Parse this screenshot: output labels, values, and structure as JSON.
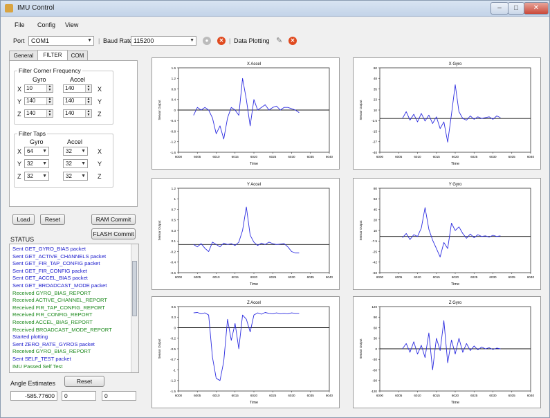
{
  "window": {
    "title": "IMU Control"
  },
  "menu": [
    "File",
    "Config",
    "View"
  ],
  "toolbar": {
    "port_label": "Port",
    "port_value": "COM1",
    "baud_label": "Baud Rate",
    "baud_value": "115200",
    "plotting_label": "Data Plotting"
  },
  "tabs": [
    "General",
    "FILTER",
    "COM"
  ],
  "filter": {
    "corner_title": "Filter Corner Frequency",
    "gyro_header": "Gyro",
    "accel_header": "Accel",
    "axes": [
      "X",
      "Y",
      "Z"
    ],
    "corner_gyro": [
      "10",
      "140",
      "140"
    ],
    "corner_accel": [
      "140",
      "140",
      "140"
    ],
    "taps_title": "Filter Taps",
    "taps_gyro": [
      "64",
      "32",
      "32"
    ],
    "taps_accel": [
      "32",
      "32",
      "32"
    ]
  },
  "buttons": {
    "load": "Load",
    "reset": "Reset",
    "ram_commit": "RAM Commit",
    "flash_commit": "FLASH Commit",
    "angle_reset": "Reset"
  },
  "status": {
    "title": "STATUS",
    "colors": {
      "sent": "#1a1acc",
      "received": "#1e8a1e"
    },
    "lines": [
      {
        "text": "Sent GET_GYRO_BIAS packet",
        "kind": "sent"
      },
      {
        "text": "Sent GET_ACTIVE_CHANNELS packet",
        "kind": "sent"
      },
      {
        "text": "Sent GET_FIR_TAP_CONFIG packet",
        "kind": "sent"
      },
      {
        "text": "Sent GET_FIR_CONFIG packet",
        "kind": "sent"
      },
      {
        "text": "Sent GET_ACCEL_BIAS packet",
        "kind": "sent"
      },
      {
        "text": "Sent GET_BROADCAST_MODE packet",
        "kind": "sent"
      },
      {
        "text": "Received GYRO_BIAS_REPORT",
        "kind": "received"
      },
      {
        "text": "Received ACTIVE_CHANNEL_REPORT",
        "kind": "received"
      },
      {
        "text": "Received FIR_TAP_CONFIG_REPORT",
        "kind": "received"
      },
      {
        "text": "Received FIR_CONFIG_REPORT",
        "kind": "received"
      },
      {
        "text": "Received ACCEL_BIAS_REPORT",
        "kind": "received"
      },
      {
        "text": "Received BROADCAST_MODE_REPORT",
        "kind": "received"
      },
      {
        "text": "Started plotting",
        "kind": "sent"
      },
      {
        "text": "Sent ZERO_RATE_GYROS packet",
        "kind": "sent"
      },
      {
        "text": "Received GYRO_BIAS_REPORT",
        "kind": "received"
      },
      {
        "text": "Sent SELF_TEST packet",
        "kind": "sent"
      },
      {
        "text": "IMU Passed Self Test",
        "kind": "received"
      }
    ]
  },
  "angles": {
    "label": "Angle Estimates",
    "values": [
      "-585.77600",
      "0",
      "0"
    ]
  },
  "chart_data": [
    {
      "type": "line",
      "title": "X Accel",
      "xlabel": "Time",
      "ylabel": "Sensor Output",
      "xlim": [
        6000,
        6040
      ],
      "ylim": [
        -1.6,
        1.6
      ],
      "x": [
        6004,
        6005,
        6006,
        6007,
        6008,
        6009,
        6010,
        6011,
        6012,
        6013,
        6014,
        6015,
        6016,
        6017,
        6018,
        6019,
        6020,
        6021,
        6022,
        6023,
        6024,
        6025,
        6026,
        6027,
        6028,
        6029,
        6030,
        6031,
        6032
      ],
      "y": [
        -0.2,
        0.1,
        0,
        0.1,
        0,
        -0.3,
        -0.9,
        -0.6,
        -1.1,
        -0.3,
        0.1,
        0,
        -0.2,
        1.2,
        0.4,
        -0.6,
        0.4,
        0,
        0.1,
        0.2,
        0,
        0.1,
        0.15,
        0,
        0.1,
        0.1,
        0.05,
        0,
        -0.1
      ]
    },
    {
      "type": "line",
      "title": "X Gyro",
      "xlabel": "Time",
      "ylabel": "Sensor Output",
      "xlim": [
        6000,
        6040
      ],
      "ylim": [
        -40,
        60
      ],
      "x": [
        6006,
        6007,
        6008,
        6009,
        6010,
        6011,
        6012,
        6013,
        6014,
        6015,
        6016,
        6017,
        6018,
        6019,
        6020,
        6021,
        6022,
        6023,
        6024,
        6025,
        6026,
        6027,
        6028,
        6029,
        6030,
        6031,
        6032
      ],
      "y": [
        0,
        8,
        -2,
        5,
        -4,
        6,
        -3,
        4,
        -6,
        2,
        -12,
        -4,
        -28,
        5,
        40,
        8,
        0,
        -2,
        3,
        -1,
        2,
        0,
        1,
        2,
        -1,
        3,
        1
      ]
    },
    {
      "type": "line",
      "title": "Y Accel",
      "xlabel": "Time",
      "ylabel": "Sensor Output",
      "xlim": [
        6000,
        6040
      ],
      "ylim": [
        -0.6,
        1.2
      ],
      "x": [
        6004,
        6005,
        6006,
        6007,
        6008,
        6009,
        6010,
        6011,
        6012,
        6013,
        6014,
        6015,
        6016,
        6017,
        6018,
        6019,
        6020,
        6021,
        6022,
        6023,
        6024,
        6025,
        6026,
        6027,
        6028,
        6029,
        6030,
        6031,
        6032
      ],
      "y": [
        0,
        -0.05,
        0.02,
        -0.08,
        -0.15,
        0.05,
        0,
        -0.05,
        0.03,
        0,
        0.02,
        -0.02,
        0.05,
        0.3,
        0.8,
        0.2,
        0.05,
        -0.02,
        0.03,
        0,
        0.05,
        0.02,
        0,
        0.01,
        0.02,
        -0.05,
        -0.15,
        -0.18,
        -0.18
      ]
    },
    {
      "type": "line",
      "title": "Y Gyro",
      "xlabel": "Time",
      "ylabel": "Sensor Output",
      "xlim": [
        6000,
        6040
      ],
      "ylim": [
        -60,
        80
      ],
      "x": [
        6006,
        6007,
        6008,
        6009,
        6010,
        6011,
        6012,
        6013,
        6014,
        6015,
        6016,
        6017,
        6018,
        6019,
        6020,
        6021,
        6022,
        6023,
        6024,
        6025,
        6026,
        6027,
        6028,
        6029,
        6030,
        6031,
        6032
      ],
      "y": [
        -2,
        5,
        -5,
        3,
        0,
        14,
        48,
        12,
        -6,
        -20,
        -34,
        -10,
        -20,
        22,
        10,
        16,
        5,
        -3,
        4,
        -2,
        3,
        0,
        1,
        -1,
        2,
        0,
        1
      ]
    },
    {
      "type": "line",
      "title": "Z Accel",
      "xlabel": "Time",
      "ylabel": "Sensor Output",
      "xlim": [
        6000,
        6040
      ],
      "ylim": [
        -1.5,
        0.5
      ],
      "x": [
        6004,
        6005,
        6006,
        6007,
        6008,
        6009,
        6010,
        6011,
        6012,
        6013,
        6014,
        6015,
        6016,
        6017,
        6018,
        6019,
        6020,
        6021,
        6022,
        6023,
        6024,
        6025,
        6026,
        6027,
        6028,
        6029,
        6030,
        6031,
        6032
      ],
      "y": [
        0.35,
        0.36,
        0.33,
        0.35,
        0.3,
        -0.7,
        -1.2,
        -1.25,
        -0.8,
        0.2,
        -0.3,
        0.1,
        -0.5,
        0.3,
        0.2,
        -0.1,
        0.3,
        0.35,
        0.32,
        0.36,
        0.34,
        0.33,
        0.35,
        0.33,
        0.34,
        0.33,
        0.35,
        0.34,
        0.34
      ]
    },
    {
      "type": "line",
      "title": "Z Gyro",
      "xlabel": "Time",
      "ylabel": "Sensor Output",
      "xlim": [
        6000,
        6040
      ],
      "ylim": [
        -120,
        120
      ],
      "x": [
        6006,
        6007,
        6008,
        6009,
        6010,
        6011,
        6012,
        6013,
        6014,
        6015,
        6016,
        6017,
        6018,
        6019,
        6020,
        6021,
        6022,
        6023,
        6024,
        6025,
        6026,
        6027,
        6028,
        6029,
        6030,
        6031,
        6032
      ],
      "y": [
        0,
        15,
        -10,
        20,
        -15,
        10,
        -25,
        45,
        -60,
        30,
        -5,
        80,
        -40,
        25,
        -15,
        30,
        -10,
        15,
        -5,
        8,
        -3,
        5,
        0,
        3,
        -2,
        2,
        0
      ]
    }
  ]
}
